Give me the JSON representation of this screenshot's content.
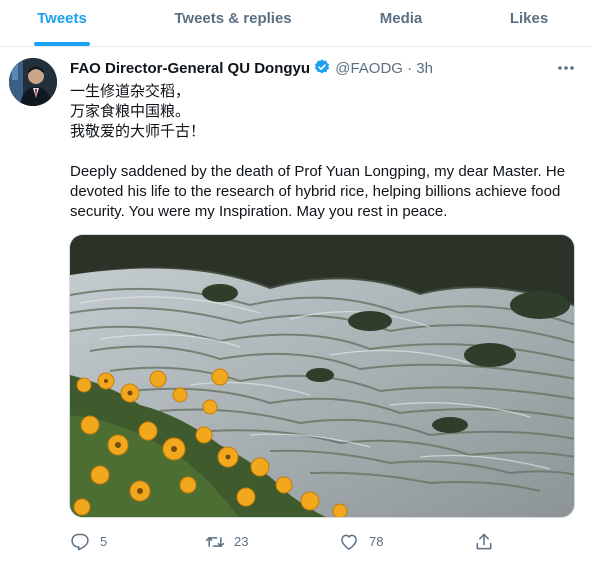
{
  "tabs": [
    {
      "label": "Tweets",
      "active": true
    },
    {
      "label": "Tweets & replies",
      "active": false
    },
    {
      "label": "Media",
      "active": false
    },
    {
      "label": "Likes",
      "active": false
    }
  ],
  "tweet": {
    "author_name": "FAO Director-General QU Dongyu",
    "handle": "@FAODG",
    "separator": "·",
    "time": "3h",
    "poem_lines": [
      "一生修道杂交稻，",
      "万家食粮中国粮。",
      "我敬爱的大师千古！"
    ],
    "body_lines": [
      "Deeply saddened by the death of Prof Yuan Longping, my dear Master. He",
      "devoted his life to the research of hybrid rice, helping billions achieve food",
      "security. You were my Inspiration. May you rest in peace."
    ],
    "media_alt": "Terraced rice fields with yellow flowers in the foreground",
    "reply_count": "5",
    "retweet_count": "23",
    "like_count": "78"
  },
  "icons": {
    "verified": "verified-badge-icon",
    "more": "more-options-icon",
    "reply": "reply-icon",
    "retweet": "retweet-icon",
    "like": "heart-icon",
    "share": "share-icon"
  },
  "colors": {
    "accent": "#1da1f2",
    "secondary_text": "#5b7083",
    "primary_text": "#0f1419"
  }
}
